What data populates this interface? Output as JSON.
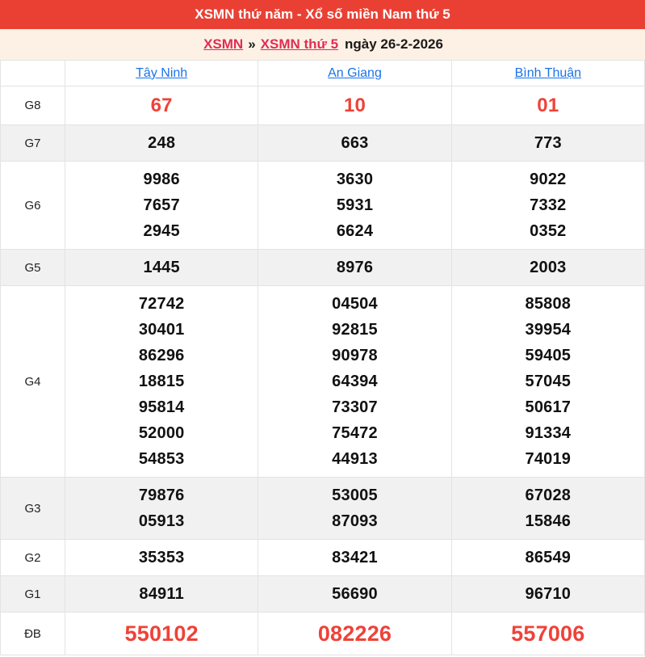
{
  "header": {
    "title": "XSMN thứ năm - Xổ số miền Nam thứ 5"
  },
  "breadcrumb": {
    "link1": "XSMN",
    "separator": "»",
    "link2": "XSMN thứ 5",
    "date_text": "ngày 26-2-2026"
  },
  "table": {
    "provinces": [
      "Tây Ninh",
      "An Giang",
      "Bình Thuận"
    ],
    "rows": [
      {
        "label": "G8",
        "shaded": false,
        "highlight": true,
        "values": [
          [
            "67"
          ],
          [
            "10"
          ],
          [
            "01"
          ]
        ]
      },
      {
        "label": "G7",
        "shaded": true,
        "highlight": false,
        "values": [
          [
            "248"
          ],
          [
            "663"
          ],
          [
            "773"
          ]
        ]
      },
      {
        "label": "G6",
        "shaded": false,
        "highlight": false,
        "values": [
          [
            "9986",
            "7657",
            "2945"
          ],
          [
            "3630",
            "5931",
            "6624"
          ],
          [
            "9022",
            "7332",
            "0352"
          ]
        ]
      },
      {
        "label": "G5",
        "shaded": true,
        "highlight": false,
        "values": [
          [
            "1445"
          ],
          [
            "8976"
          ],
          [
            "2003"
          ]
        ]
      },
      {
        "label": "G4",
        "shaded": false,
        "highlight": false,
        "values": [
          [
            "72742",
            "30401",
            "86296",
            "18815",
            "95814",
            "52000",
            "54853"
          ],
          [
            "04504",
            "92815",
            "90978",
            "64394",
            "73307",
            "75472",
            "44913"
          ],
          [
            "85808",
            "39954",
            "59405",
            "57045",
            "50617",
            "91334",
            "74019"
          ]
        ]
      },
      {
        "label": "G3",
        "shaded": true,
        "highlight": false,
        "values": [
          [
            "79876",
            "05913"
          ],
          [
            "53005",
            "87093"
          ],
          [
            "67028",
            "15846"
          ]
        ]
      },
      {
        "label": "G2",
        "shaded": false,
        "highlight": false,
        "values": [
          [
            "35353"
          ],
          [
            "83421"
          ],
          [
            "86549"
          ]
        ]
      },
      {
        "label": "G1",
        "shaded": true,
        "highlight": false,
        "values": [
          [
            "84911"
          ],
          [
            "56690"
          ],
          [
            "96710"
          ]
        ]
      },
      {
        "label": "ĐB",
        "shaded": false,
        "highlight": true,
        "values": [
          [
            "550102"
          ],
          [
            "082226"
          ],
          [
            "557006"
          ]
        ]
      }
    ]
  },
  "colors": {
    "header_bg": "#ea4034",
    "breadcrumb_bg": "#fdf1e5",
    "breadcrumb_link_red": "#e02d55",
    "province_link_blue": "#1a73e8",
    "highlight_number_red": "#ef4238",
    "shaded_row_bg": "#f1f1f1",
    "border": "#e3e3e3"
  }
}
